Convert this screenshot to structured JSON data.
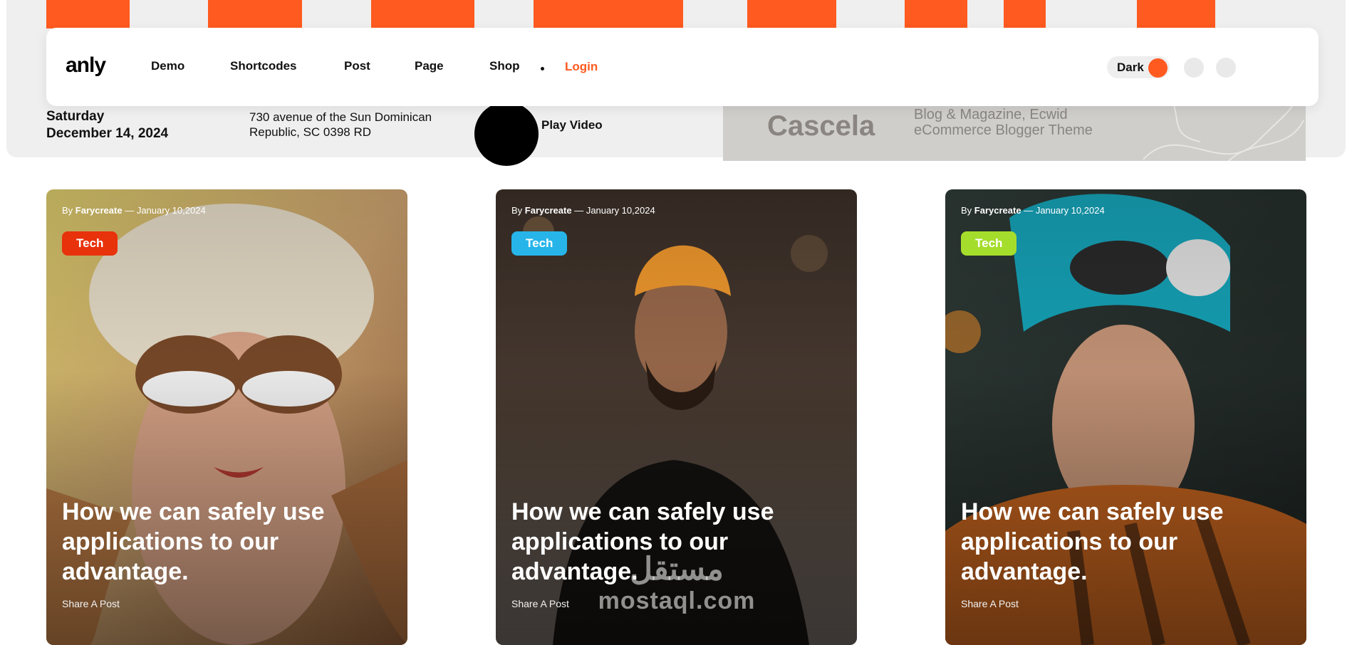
{
  "header": {
    "logo": "anly",
    "nav": [
      {
        "label": "Demo"
      },
      {
        "label": "Shortcodes"
      },
      {
        "label": "Post"
      },
      {
        "label": "Page"
      },
      {
        "label": "Shop"
      }
    ],
    "login": "Login",
    "theme_toggle_label": "Dark",
    "accent_color": "#ff5a1f"
  },
  "info": {
    "day": "Saturday",
    "date": "December 14, 2024",
    "address_line1": "730 avenue of the Sun Dominican",
    "address_line2": "Republic, SC 0398 RD",
    "play_label": "Play Video"
  },
  "banner": {
    "name": "Cascela",
    "tagline_line1": "Blog & Magazine, Ecwid",
    "tagline_line2": "eCommerce Blogger Theme"
  },
  "posts": [
    {
      "by": "By",
      "author": "Farycreate",
      "date": "— January 10,2024",
      "tag": "Tech",
      "tag_color": "#e8320c",
      "title": "How we can safely use applications to our advantage.",
      "share": "Share A Post"
    },
    {
      "by": "By",
      "author": "Farycreate",
      "date": "— January 10,2024",
      "tag": "Tech",
      "tag_color": "#27b5e9",
      "title": "How we can safely use applications to our advantage.",
      "share": "Share A Post"
    },
    {
      "by": "By",
      "author": "Farycreate",
      "date": "— January 10,2024",
      "tag": "Tech",
      "tag_color": "#a5dd2c",
      "title": "How we can safely use applications to our advantage.",
      "share": "Share A Post"
    }
  ],
  "watermark": {
    "arabic": "مستقل",
    "latin": "mostaql.com"
  }
}
